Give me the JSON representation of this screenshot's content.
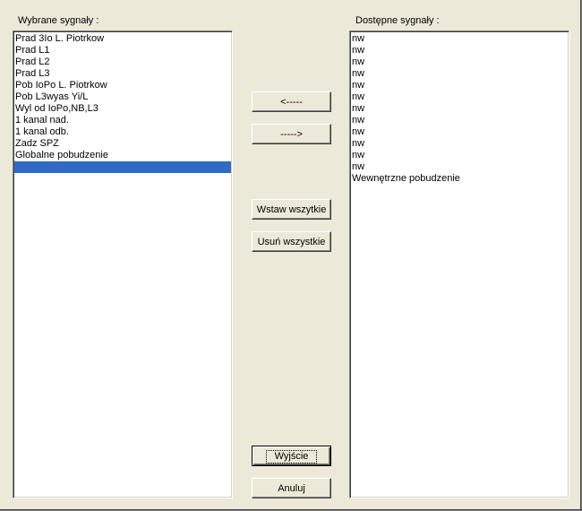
{
  "left_panel": {
    "label": "Wybrane sygnały :",
    "items": [
      "Prad 3Io L. Piotrkow",
      "Prad L1",
      "Prad L2",
      "Prad L3",
      "Pob IoPo L. Piotrkow",
      "Pob L3wyas Yi/L",
      "Wyl od IoPo,NB,L3",
      "1 kanal nad.",
      "1 kanal odb.",
      "Zadz SPZ",
      "Globalne pobudzenie",
      ""
    ],
    "selected_index": 11
  },
  "right_panel": {
    "label": "Dostępne sygnały :",
    "items": [
      "nw",
      "nw",
      "nw",
      "nw",
      "nw",
      "nw",
      "nw",
      "nw",
      "nw",
      "nw",
      "nw",
      "nw",
      "Wewnętrzne pobudzenie"
    ]
  },
  "buttons": {
    "move_left": "<-----",
    "move_right": "----->",
    "insert_all": "Wstaw wszytkie",
    "remove_all": "Usuń wszystkie",
    "exit": "Wyjście",
    "cancel": "Anuluj"
  },
  "colors": {
    "background": "#ece9d8",
    "selection": "#316ac5"
  }
}
